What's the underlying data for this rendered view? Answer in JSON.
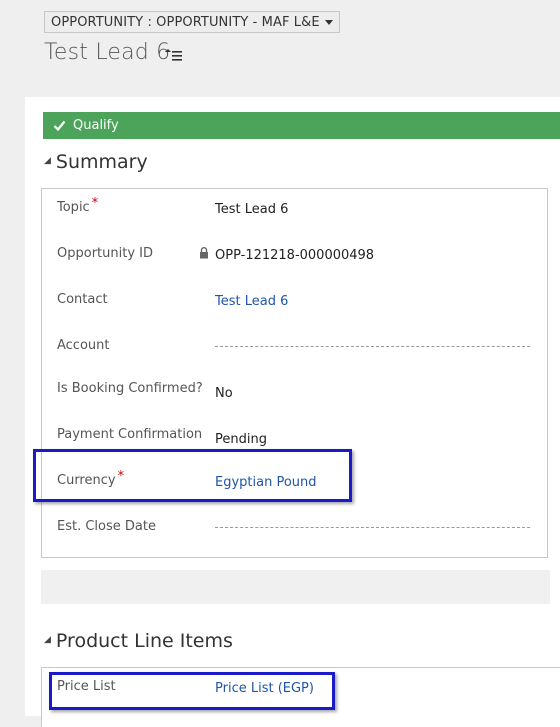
{
  "header": {
    "entity_selector": "OPPORTUNITY : OPPORTUNITY - MAF L&E",
    "record_title": "Test Lead 6"
  },
  "process_bar": {
    "qualify_label": "Qualify",
    "color": "#4ca45a"
  },
  "summary": {
    "section_title": "Summary",
    "fields": [
      {
        "label": "Topic",
        "required": "*",
        "value": "Test Lead 6"
      },
      {
        "label": "Opportunity ID",
        "value": "OPP-121218-000000498"
      },
      {
        "label": "Contact",
        "value": "Test Lead 6"
      },
      {
        "label": "Account",
        "value": ""
      },
      {
        "label": "Is Booking Confirmed?",
        "value": "No"
      },
      {
        "label": "Payment Confirmation",
        "value": "Pending"
      },
      {
        "label": "Currency",
        "required": "*",
        "value": "Egyptian Pound"
      },
      {
        "label": "Est. Close Date",
        "value": ""
      }
    ]
  },
  "product_line_items": {
    "section_title": "Product Line Items",
    "price_list_label": "Price List",
    "price_list_value": "Price List (EGP)"
  },
  "colors": {
    "link": "#1f56a8",
    "highlight": "#1a1ac8",
    "required": "#cc0000"
  }
}
